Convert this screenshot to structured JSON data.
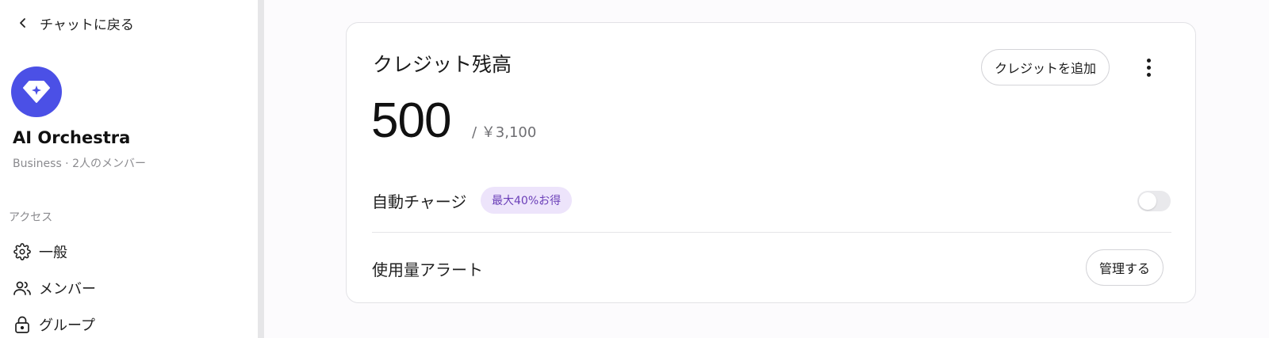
{
  "sidebar": {
    "back_label": "チャットに戻る",
    "org": {
      "name": "AI Orchestra",
      "plan_line": "Business · 2人のメンバー",
      "logo_color": "#4b50e6"
    },
    "section_label": "アクセス",
    "items": [
      {
        "label": "一般",
        "icon": "gear-icon"
      },
      {
        "label": "メンバー",
        "icon": "users-icon"
      },
      {
        "label": "グループ",
        "icon": "lock-icon"
      }
    ]
  },
  "credit_card": {
    "title": "クレジット残高",
    "add_credit_label": "クレジットを追加",
    "balance": "500",
    "balance_sub": "/ ￥3,100",
    "auto_charge": {
      "label": "自動チャージ",
      "badge": "最大40%お得",
      "enabled": false
    },
    "usage_alert": {
      "label": "使用量アラート",
      "manage_label": "管理する"
    }
  },
  "colors": {
    "accent": "#4b50e6",
    "badge_bg": "#ede4fb",
    "badge_text": "#6b3fb8"
  }
}
